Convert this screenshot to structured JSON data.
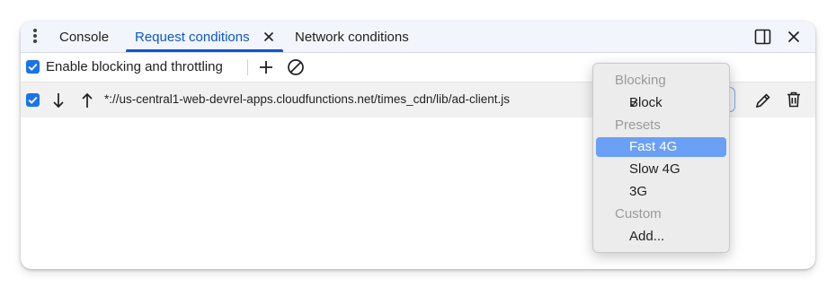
{
  "tabs": {
    "console": "Console",
    "request_conditions": "Request conditions",
    "network_conditions": "Network conditions"
  },
  "toolbar": {
    "enable_label": "Enable blocking and throttling",
    "enable_checked": true
  },
  "rows": [
    {
      "checked": true,
      "pattern": "*://us-central1-web-devrel-apps.cloudfunctions.net/times_cdn/lib/ad-client.js"
    }
  ],
  "dropdown": {
    "group_blocking": "Blocking",
    "block": "Block",
    "block_check": "✓",
    "group_presets": "Presets",
    "fast_4g": "Fast 4G",
    "slow_4g": "Slow 4G",
    "three_g": "3G",
    "group_custom": "Custom",
    "add": "Add..."
  },
  "colors": {
    "accent": "#0b57d0",
    "checkbox": "#1a73e8",
    "highlight": "#6aa0f5"
  }
}
